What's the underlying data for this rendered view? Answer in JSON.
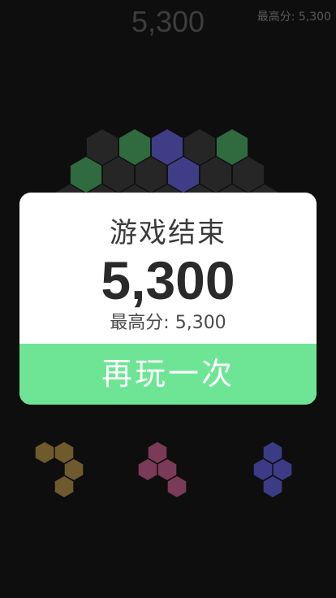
{
  "score": "5,300",
  "best_header": "最高分: 5,300",
  "overlay": {
    "title": "游戏结束",
    "score": "5,300",
    "best": "最高分: 5,300",
    "button": "再玩一次"
  },
  "colors": {
    "background": "#0e0e0e",
    "empty_cell": "#262626",
    "green": "#2f6b3e",
    "purple": "#3e3d86",
    "olive": "#6e5a2c",
    "pink": "#7a3a58",
    "navy": "#3b3b86",
    "button": "#6ee595"
  },
  "board": {
    "filled_cells": [
      {
        "color": "green"
      },
      {
        "color": "purple"
      },
      {
        "color": "green"
      },
      {
        "color": "green"
      },
      {
        "color": "purple"
      }
    ]
  },
  "pieces": [
    {
      "name": "piece-olive",
      "color": "olive"
    },
    {
      "name": "piece-pink",
      "color": "pink"
    },
    {
      "name": "piece-navy",
      "color": "navy"
    }
  ]
}
